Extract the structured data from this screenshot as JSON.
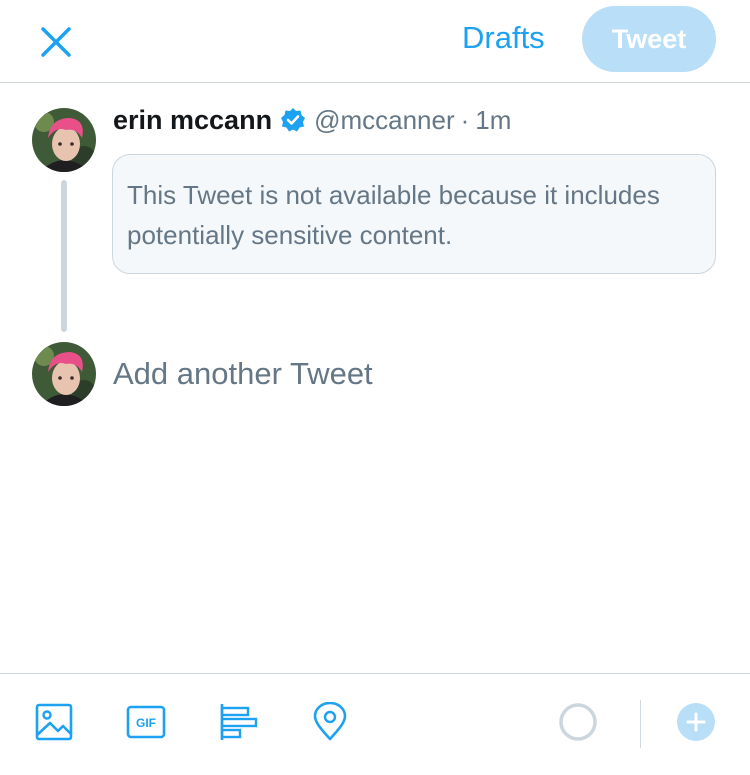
{
  "header": {
    "close_icon": "close-icon",
    "drafts_label": "Drafts",
    "tweet_label": "Tweet"
  },
  "tweet": {
    "author_name": "erin mccann",
    "handle": "@mccanner",
    "time_sep": "·",
    "time": "1m",
    "verified": true,
    "unavailable_text": "This Tweet is not available because it includes potentially sensitive content."
  },
  "composer": {
    "placeholder": "Add another Tweet"
  },
  "toolbar": {
    "icons": [
      "image-icon",
      "gif-icon",
      "poll-icon",
      "location-icon",
      "character-count-icon",
      "add-tweet-icon"
    ],
    "gif_label": "GIF"
  },
  "colors": {
    "accent": "#1da1f2",
    "tweet_button_disabled": "#b9def7",
    "muted_text": "#657786",
    "border": "#ccd6dd"
  }
}
